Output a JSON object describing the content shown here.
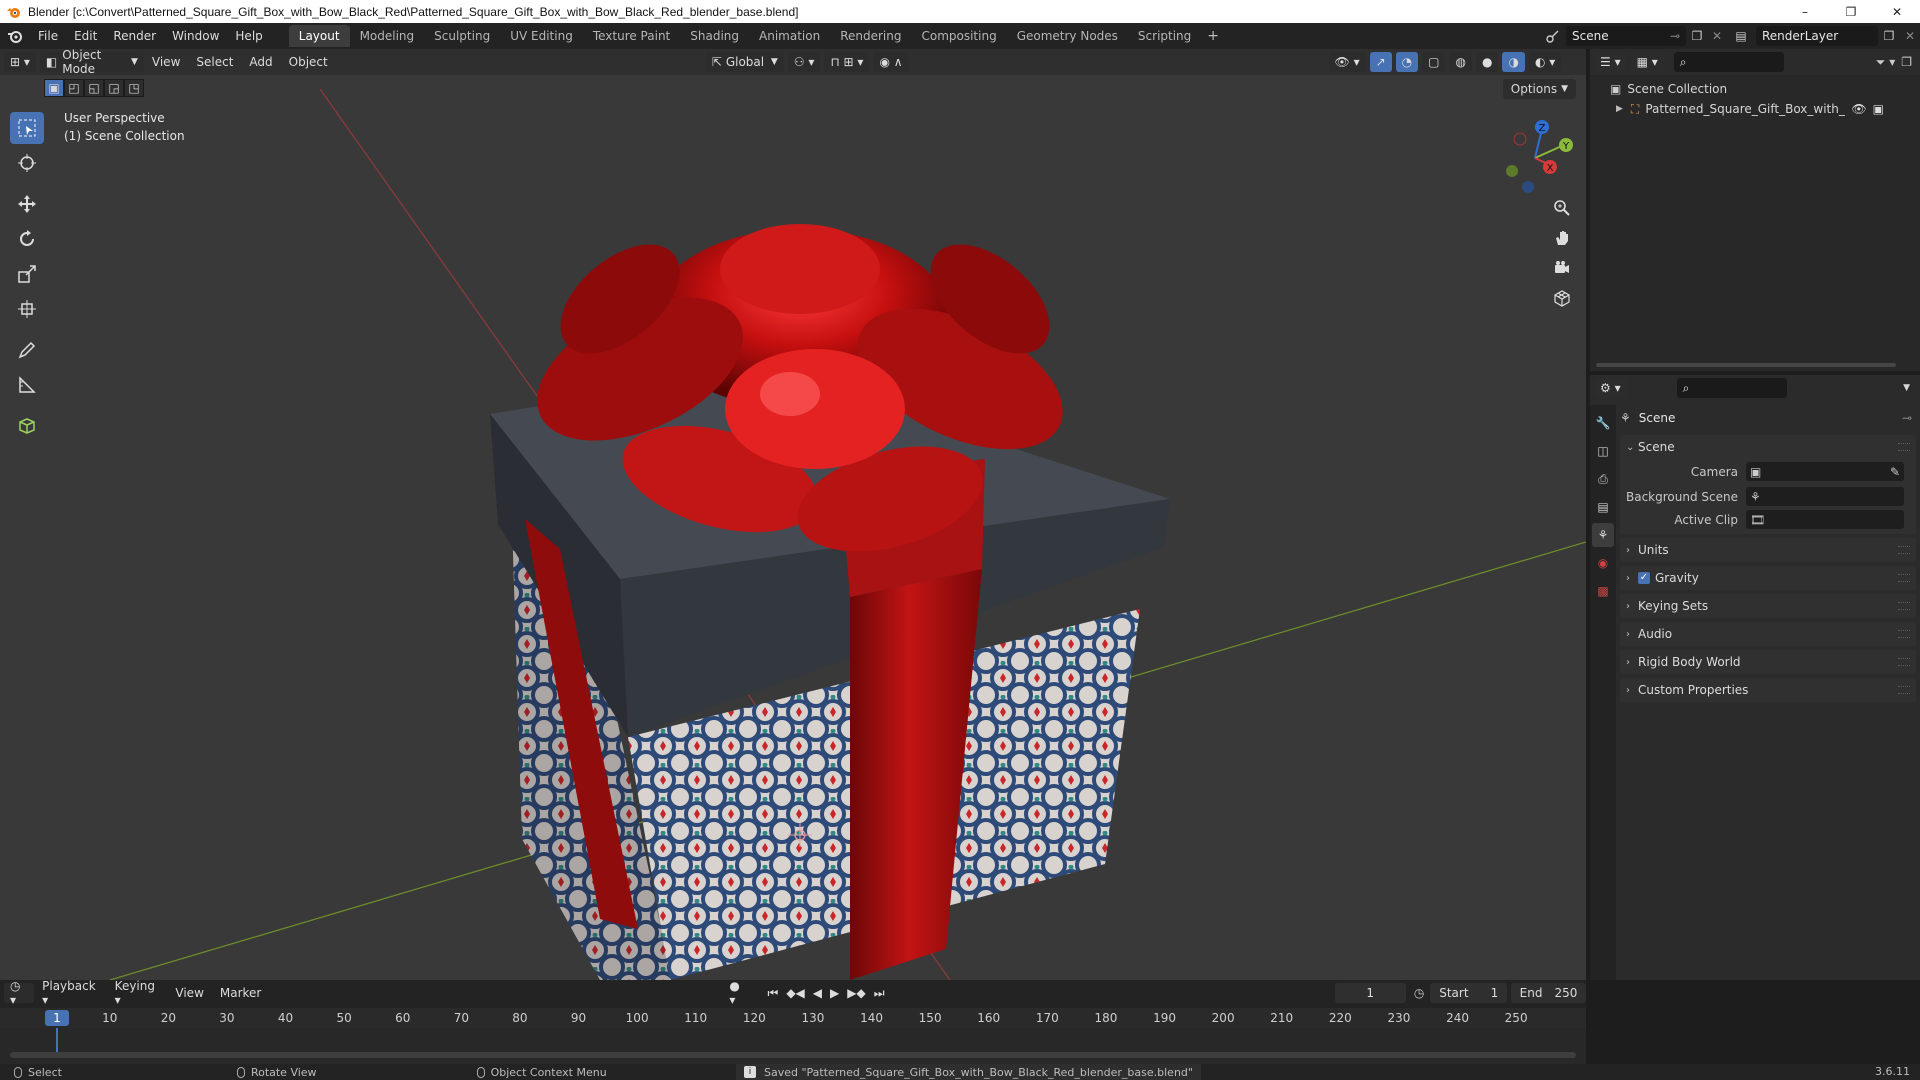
{
  "window": {
    "title": "Blender [c:\\Convert\\Patterned_Square_Gift_Box_with_Bow_Black_Red\\Patterned_Square_Gift_Box_with_Bow_Black_Red_blender_base.blend]",
    "controls": [
      "–",
      "❐",
      "✕"
    ]
  },
  "menu": [
    "File",
    "Edit",
    "Render",
    "Window",
    "Help"
  ],
  "workspaces": [
    {
      "label": "Layout",
      "active": true
    },
    {
      "label": "Modeling"
    },
    {
      "label": "Sculpting"
    },
    {
      "label": "UV Editing"
    },
    {
      "label": "Texture Paint"
    },
    {
      "label": "Shading"
    },
    {
      "label": "Animation"
    },
    {
      "label": "Rendering"
    },
    {
      "label": "Compositing"
    },
    {
      "label": "Geometry Nodes"
    },
    {
      "label": "Scripting"
    }
  ],
  "workspace_add": "+",
  "scene_name": "Scene",
  "view_layer": "RenderLayer",
  "viewport": {
    "mode": "Object Mode",
    "menus": [
      "View",
      "Select",
      "Add",
      "Object"
    ],
    "orientation": "Global",
    "options_label": "Options",
    "perspective_label": "User Perspective",
    "collection_label": "(1) Scene Collection",
    "gizmo": {
      "x": "X",
      "y": "Y",
      "z": "Z"
    }
  },
  "outliner": {
    "root": "Scene Collection",
    "items": [
      {
        "label": "Patterned_Square_Gift_Box_with_Bow_E"
      }
    ]
  },
  "properties": {
    "header": "Scene",
    "panel_scene": "Scene",
    "fields": [
      {
        "label": "Camera"
      },
      {
        "label": "Background Scene"
      },
      {
        "label": "Active Clip"
      }
    ],
    "panels": [
      {
        "label": "Units",
        "checkbox": false
      },
      {
        "label": "Gravity",
        "checkbox": true
      },
      {
        "label": "Keying Sets",
        "checkbox": false
      },
      {
        "label": "Audio",
        "checkbox": false
      },
      {
        "label": "Rigid Body World",
        "checkbox": false
      },
      {
        "label": "Custom Properties",
        "checkbox": false
      }
    ]
  },
  "timeline": {
    "menus": [
      "Playback",
      "Keying",
      "View",
      "Marker"
    ],
    "current_frame": "1",
    "start_label": "Start",
    "start_value": "1",
    "end_label": "End",
    "end_value": "250",
    "ticks": [
      "10",
      "20",
      "30",
      "40",
      "50",
      "60",
      "70",
      "80",
      "90",
      "100",
      "110",
      "120",
      "130",
      "140",
      "150",
      "160",
      "170",
      "180",
      "190",
      "200",
      "210",
      "220",
      "230",
      "240",
      "250"
    ],
    "marker": "1"
  },
  "status": {
    "select": "Select",
    "rotate": "Rotate View",
    "context": "Object Context Menu",
    "message": "Saved \"Patterned_Square_Gift_Box_with_Bow_Black_Red_blender_base.blend\"",
    "version": "3.6.11"
  },
  "colors": {
    "accent": "#4772b3",
    "viewport_bg": "#393939",
    "ribbon_red": "#b01212",
    "lid_dark": "#41464d"
  }
}
